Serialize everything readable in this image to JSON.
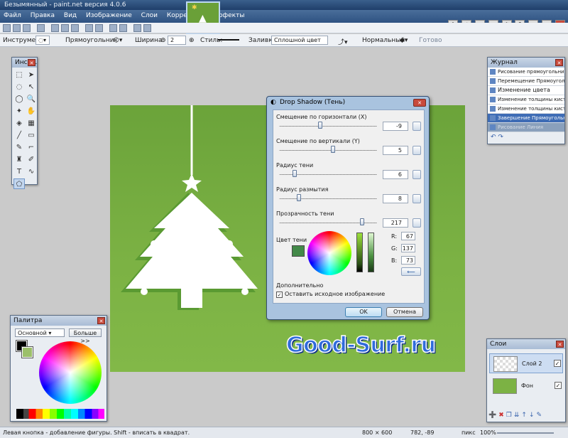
{
  "window": {
    "title": "Безымянный - paint.net версия 4.0.6"
  },
  "menu": [
    "Файл",
    "Правка",
    "Вид",
    "Изображение",
    "Слои",
    "Коррекция",
    "Эффекты"
  ],
  "toolbar": {
    "tool_label": "Инструмент:",
    "shape": "Прямоугольник",
    "width_label": "Ширина:",
    "width_value": "2",
    "style_label": "Стиль:",
    "fill_label": "Заливка:",
    "fill_value": "Сплошной цвет",
    "blend_value": "Нормальный",
    "done_label": "Готово"
  },
  "tools_panel": {
    "title": "Инст...",
    "selected": "shapes"
  },
  "history_panel": {
    "title": "Журнал",
    "items": [
      "Рисование прямоугольника",
      "Перемещение Прямоугольник",
      "Изменение цвета",
      "Изменение толщины кисти",
      "Изменение толщины кисти",
      "Завершение Прямоугольник",
      "Рисование Линия"
    ],
    "current_index": 5
  },
  "palette": {
    "title": "Палитра",
    "dropdown": "Основной",
    "more_button": "Больше >>",
    "primary_color": "#000000",
    "secondary_color": "#9cc06a"
  },
  "layers": {
    "title": "Слои",
    "items": [
      {
        "name": "Слой 2",
        "visible": true,
        "selected": true
      },
      {
        "name": "Фон",
        "visible": true,
        "selected": false
      }
    ]
  },
  "dialog": {
    "title": "Drop Shadow (Тень)",
    "params": [
      {
        "label": "Смещение по горизонтали (X)",
        "value": "-9",
        "fraction": 0.42
      },
      {
        "label": "Смещение по вертикали (Y)",
        "value": "5",
        "fraction": 0.55
      },
      {
        "label": "Радиус тени",
        "value": "6",
        "fraction": 0.16
      },
      {
        "label": "Радиус размытия",
        "value": "8",
        "fraction": 0.2
      },
      {
        "label": "Прозрачность тени",
        "value": "217",
        "fraction": 0.85
      }
    ],
    "color_label": "Цвет тени",
    "color": "#438949",
    "rgb": {
      "r_label": "R:",
      "r": "67",
      "g_label": "G:",
      "g": "137",
      "b_label": "B:",
      "b": "73"
    },
    "extra_label": "Дополнительно",
    "keep_original_label": "Оставить исходное изображение",
    "keep_original": true,
    "ok": "OK",
    "cancel": "Отмена"
  },
  "watermark": "Good-Surf.ru",
  "status": {
    "hint": "Левая кнопка - добавление фигуры. Shift - вписать в квадрат.",
    "size": "800 × 600",
    "cursor": "782, -89",
    "unit": "пикс",
    "zoom": "100%"
  },
  "colors": {
    "canvas_green": "#76ac40",
    "accent_blue": "#2f6bdc"
  }
}
